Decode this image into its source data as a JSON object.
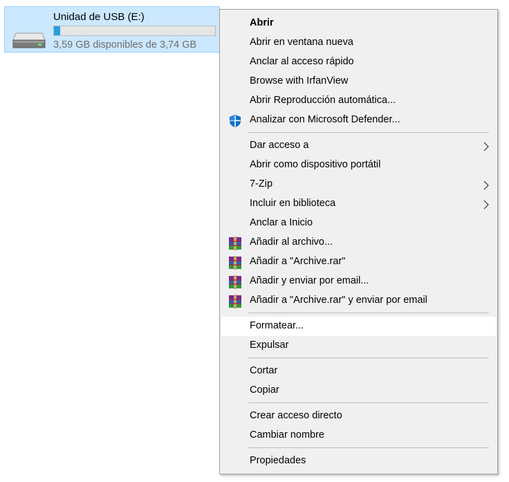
{
  "drive": {
    "name": "Unidad de USB (E:)",
    "free_text": "3,59 GB disponibles de 3,74 GB",
    "used_fraction": 0.04,
    "icon": "usb-drive-icon"
  },
  "menu": {
    "items": [
      {
        "label": "Abrir",
        "bold": true
      },
      {
        "label": "Abrir en ventana nueva"
      },
      {
        "label": "Anclar al acceso rápido"
      },
      {
        "label": "Browse with IrfanView"
      },
      {
        "label": "Abrir Reproducción automática..."
      },
      {
        "label": "Analizar con Microsoft Defender...",
        "icon": "defender-shield-icon"
      },
      {
        "label": "Dar acceso a",
        "submenu": true
      },
      {
        "label": "Abrir como dispositivo portátil"
      },
      {
        "label": "7-Zip",
        "submenu": true
      },
      {
        "label": "Incluir en biblioteca",
        "submenu": true
      },
      {
        "label": "Anclar a Inicio"
      },
      {
        "label": "Añadir al archivo...",
        "icon": "winrar-icon"
      },
      {
        "label": "Añadir a \"Archive.rar\"",
        "icon": "winrar-icon"
      },
      {
        "label": "Añadir y enviar por email...",
        "icon": "winrar-icon"
      },
      {
        "label": "Añadir a \"Archive.rar\" y enviar por email",
        "icon": "winrar-icon"
      },
      {
        "label": "Formatear...",
        "highlighted": true
      },
      {
        "label": "Expulsar"
      },
      {
        "label": "Cortar"
      },
      {
        "label": "Copiar"
      },
      {
        "label": "Crear acceso directo"
      },
      {
        "label": "Cambiar nombre"
      },
      {
        "label": "Propiedades"
      }
    ]
  },
  "colors": {
    "selection_bg": "#cce8ff",
    "progress_fill": "#26a0da",
    "menu_bg": "#f0f0f0",
    "hover_bg": "#ffffff"
  }
}
